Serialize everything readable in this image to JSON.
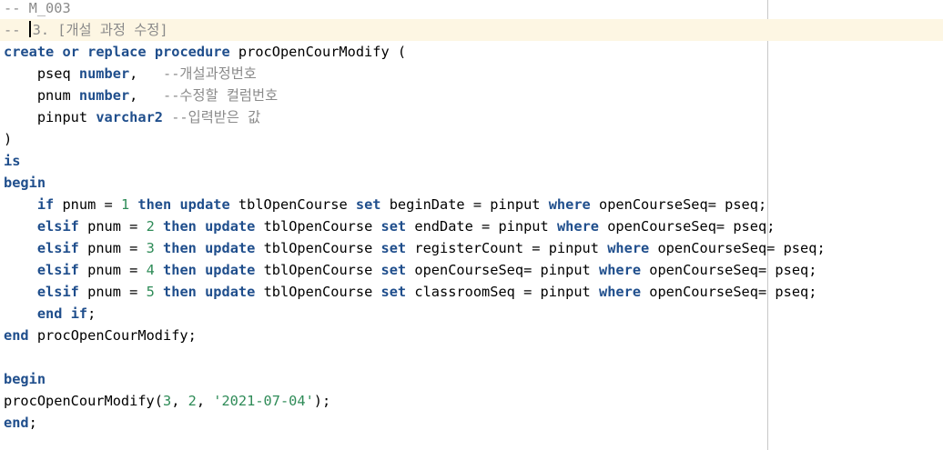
{
  "editor": {
    "line1": {
      "comment": "-- M_003"
    },
    "line2": {
      "comment_a": "-- ",
      "comment_b": "3. [개설 과정 수정]"
    },
    "line3": {
      "k1": "create",
      "s1": " ",
      "k2": "or",
      "s2": " ",
      "k3": "replace",
      "s3": " ",
      "k4": "procedure",
      "rest": " procOpenCourModify ("
    },
    "line4": {
      "indent": "    pseq ",
      "type": "number",
      "rest": ",   ",
      "comment": "--개설과정번호"
    },
    "line5": {
      "indent": "    pnum ",
      "type": "number",
      "rest": ",   ",
      "comment": "--수정할 컬럼번호"
    },
    "line6": {
      "indent": "    pinput ",
      "type": "varchar2",
      "rest": " ",
      "comment": "--입력받은 값"
    },
    "line7": {
      "text": ")"
    },
    "line8": {
      "kw": "is"
    },
    "line9": {
      "kw": "begin"
    },
    "line10": {
      "indent": "    ",
      "k1": "if",
      "t1": " pnum = ",
      "n": "1",
      "s1": " ",
      "k2": "then",
      "s2": " ",
      "k3": "update",
      "t2": " tblOpenCourse ",
      "k4": "set",
      "t3": " beginDate = pinput ",
      "k5": "where",
      "t4": " openCourseSeq= pseq;"
    },
    "line11": {
      "indent": "    ",
      "k1": "elsif",
      "t1": " pnum = ",
      "n": "2",
      "s1": " ",
      "k2": "then",
      "s2": " ",
      "k3": "update",
      "t2": " tblOpenCourse ",
      "k4": "set",
      "t3": " endDate = pinput ",
      "k5": "where",
      "t4": " openCourseSeq= pseq;"
    },
    "line12": {
      "indent": "    ",
      "k1": "elsif",
      "t1": " pnum = ",
      "n": "3",
      "s1": " ",
      "k2": "then",
      "s2": " ",
      "k3": "update",
      "t2": " tblOpenCourse ",
      "k4": "set",
      "t3": " registerCount = pinput ",
      "k5": "where",
      "t4": " openCourseSeq= pseq;"
    },
    "line13": {
      "indent": "    ",
      "k1": "elsif",
      "t1": " pnum = ",
      "n": "4",
      "s1": " ",
      "k2": "then",
      "s2": " ",
      "k3": "update",
      "t2": " tblOpenCourse ",
      "k4": "set",
      "t3": " openCourseSeq= pinput ",
      "k5": "where",
      "t4": " openCourseSeq= pseq;"
    },
    "line14": {
      "indent": "    ",
      "k1": "elsif",
      "t1": " pnum = ",
      "n": "5",
      "s1": " ",
      "k2": "then",
      "s2": " ",
      "k3": "update",
      "t2": " tblOpenCourse ",
      "k4": "set",
      "t3": " classroomSeq = pinput ",
      "k5": "where",
      "t4": " openCourseSeq= pseq;"
    },
    "line15": {
      "indent": "    ",
      "k1": "end",
      "s1": " ",
      "k2": "if",
      "rest": ";"
    },
    "line16": {
      "k1": "end",
      "rest": " procOpenCourModify;"
    },
    "line17": {
      "text": ""
    },
    "line18": {
      "kw": "begin"
    },
    "line19": {
      "t1": "procOpenCourModify(",
      "n1": "3",
      "t2": ", ",
      "n2": "2",
      "t3": ", ",
      "str": "'2021-07-04'",
      "t4": ");"
    },
    "line20": {
      "kw": "end",
      "rest": ";"
    }
  },
  "colors": {
    "keyword": "#1f4e8c",
    "comment": "#8a8a8a",
    "number": "#2e8b57",
    "current_line": "#fdf6e3"
  }
}
